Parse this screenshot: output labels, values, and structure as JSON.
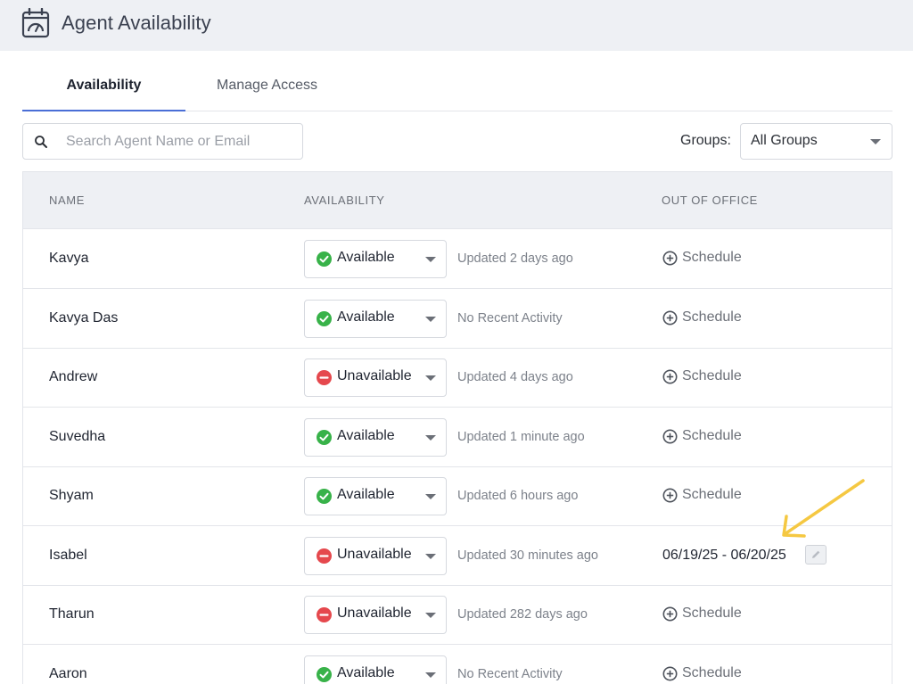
{
  "header": {
    "title": "Agent Availability",
    "icon": "calendar-gauge-icon"
  },
  "tabs": [
    {
      "label": "Availability",
      "active": true
    },
    {
      "label": "Manage Access",
      "active": false
    }
  ],
  "search": {
    "placeholder": "Search Agent Name or Email",
    "value": "",
    "icon": "search-icon"
  },
  "groups": {
    "label": "Groups:",
    "selected": "All Groups"
  },
  "table": {
    "columns": {
      "name": "NAME",
      "availability": "AVAILABILITY",
      "ooo": "OUT OF OFFICE"
    },
    "rows": [
      {
        "name": "Kavya",
        "status": "Available",
        "updated": "Updated 2 days ago",
        "ooo": "Schedule"
      },
      {
        "name": "Kavya Das",
        "status": "Available",
        "updated": "No Recent Activity",
        "ooo": "Schedule"
      },
      {
        "name": "Andrew",
        "status": "Unavailable",
        "updated": "Updated 4 days ago",
        "ooo": "Schedule"
      },
      {
        "name": "Suvedha",
        "status": "Available",
        "updated": "Updated 1 minute ago",
        "ooo": "Schedule"
      },
      {
        "name": "Shyam",
        "status": "Available",
        "updated": "Updated 6 hours ago",
        "ooo": "Schedule"
      },
      {
        "name": "Isabel",
        "status": "Unavailable",
        "updated": "Updated 30 minutes ago",
        "ooo": "06/19/25 - 06/20/25"
      },
      {
        "name": "Tharun",
        "status": "Unavailable",
        "updated": "Updated 282 days ago",
        "ooo": "Schedule"
      },
      {
        "name": "Aaron",
        "status": "Available",
        "updated": "No Recent Activity",
        "ooo": "Schedule"
      }
    ]
  },
  "colors": {
    "available": "#38b249",
    "unavailable": "#e5484d",
    "accent": "#4a6ed6",
    "annotation": "#f5c842"
  }
}
